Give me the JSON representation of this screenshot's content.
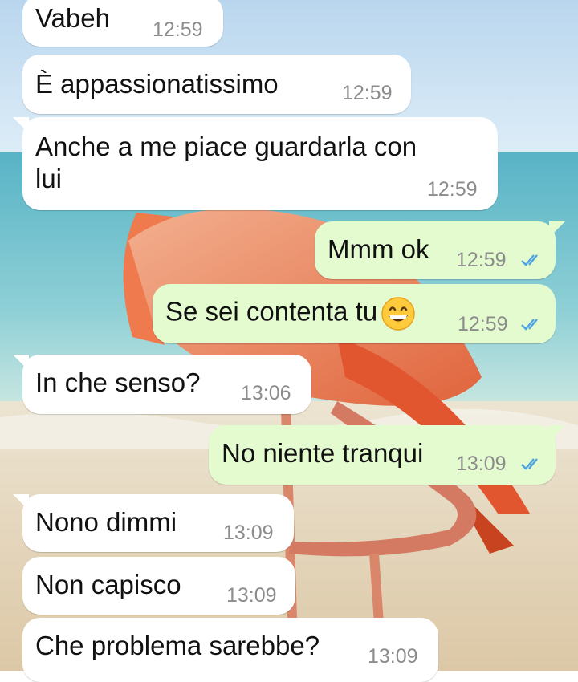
{
  "wallpaper": {
    "description_icon": "flamingo-beach-wallpaper-icon"
  },
  "colors": {
    "incoming": "#ffffff",
    "outgoing": "#e4fbd0",
    "timestamp": "#8c8c8c",
    "tick": "#4fa3e0"
  },
  "messages": [
    {
      "dir": "in",
      "text": "Vabeh",
      "time": "12:59"
    },
    {
      "dir": "in",
      "text": "È appassionatissimo",
      "time": "12:59"
    },
    {
      "dir": "in",
      "text_line1": "Anche a me piace guardarla con",
      "text_line2": "lui",
      "time": "12:59"
    },
    {
      "dir": "out",
      "text": "Mmm ok",
      "time": "12:59",
      "status": "read-ticks-icon"
    },
    {
      "dir": "out",
      "text": "Se sei contenta tu",
      "emoji": "grinning-face-icon",
      "time": "12:59",
      "status": "read-ticks-icon"
    },
    {
      "dir": "in",
      "text": "In che senso?",
      "time": "13:06"
    },
    {
      "dir": "out",
      "text": "No niente tranqui",
      "time": "13:09",
      "status": "read-ticks-icon"
    },
    {
      "dir": "in",
      "text": "Nono dimmi",
      "time": "13:09"
    },
    {
      "dir": "in",
      "text": "Non capisco",
      "time": "13:09"
    },
    {
      "dir": "in",
      "text": "Che problema sarebbe?",
      "time": "13:09"
    }
  ]
}
